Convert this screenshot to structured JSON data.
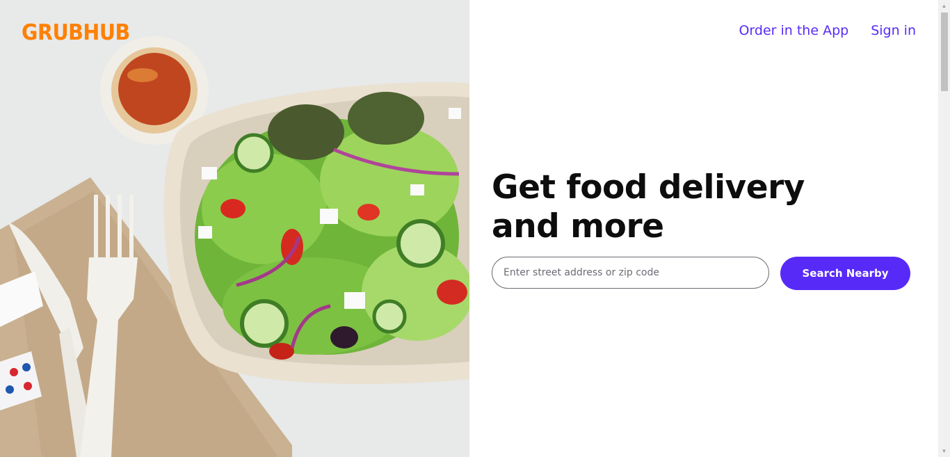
{
  "brand": {
    "logo_text": "GRUBHUB",
    "logo_color": "#ff8000",
    "accent": "#572af8"
  },
  "nav": {
    "order_app_label": "Order in the App",
    "sign_in_label": "Sign in"
  },
  "hero": {
    "headline": "Get food delivery and more",
    "image_description_icon": "salad-photo"
  },
  "search": {
    "placeholder": "Enter street address or zip code",
    "value": "",
    "button_label": "Search Nearby"
  }
}
